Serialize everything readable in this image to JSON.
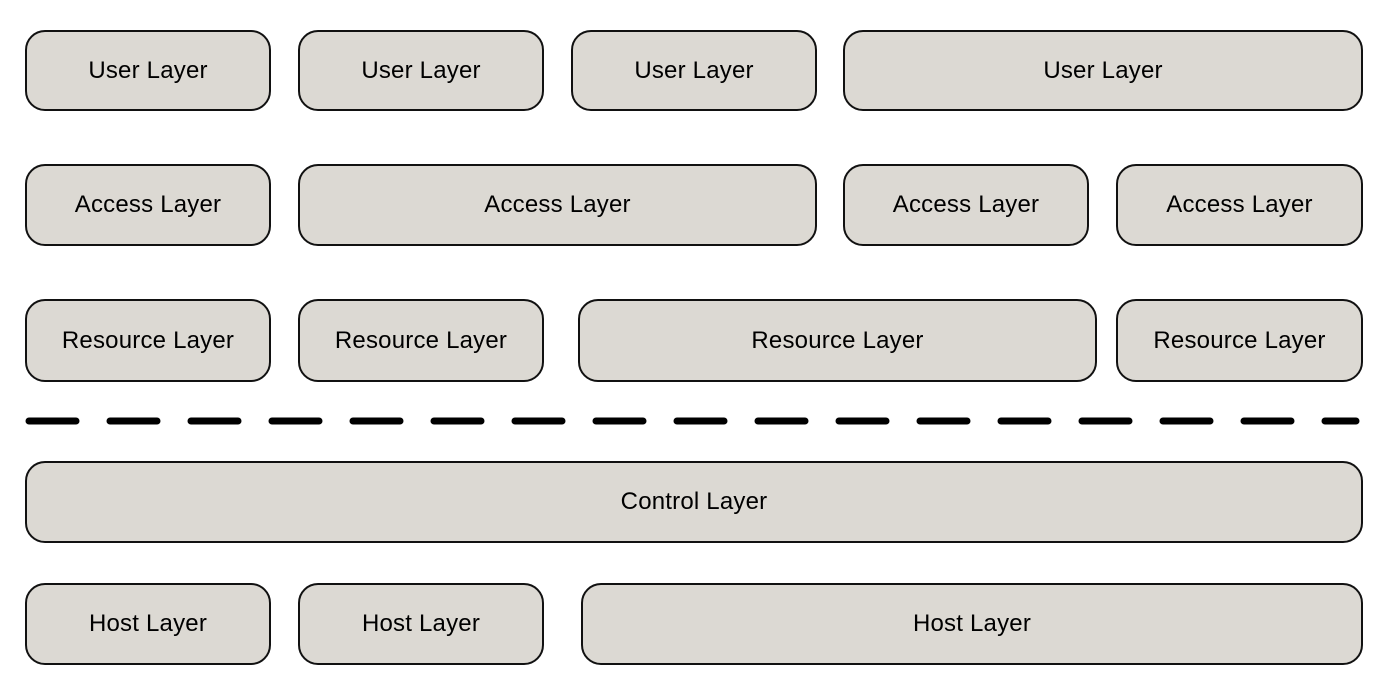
{
  "rows": {
    "user": [
      "User Layer",
      "User Layer",
      "User Layer",
      "User Layer"
    ],
    "access": [
      "Access Layer",
      "Access Layer",
      "Access Layer",
      "Access Layer"
    ],
    "resource": [
      "Resource Layer",
      "Resource Layer",
      "Resource Layer",
      "Resource Layer"
    ],
    "control": [
      "Control Layer"
    ],
    "host": [
      "Host Layer",
      "Host Layer",
      "Host Layer"
    ]
  },
  "colors": {
    "box_fill": "#dcd9d3",
    "border": "#111111",
    "divider": "#000000"
  },
  "divider_style": "dashed"
}
